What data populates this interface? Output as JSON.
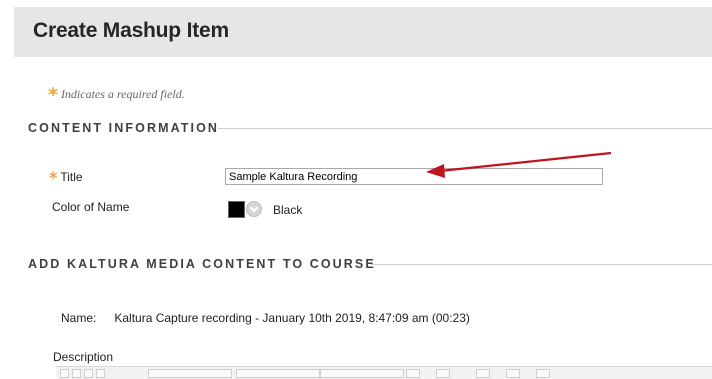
{
  "page": {
    "title": "Create Mashup Item"
  },
  "required_note": {
    "symbol": "*",
    "text": "Indicates a required field."
  },
  "sections": {
    "content_information": "CONTENT INFORMATION",
    "add_kaltura": "ADD KALTURA MEDIA CONTENT TO COURSE"
  },
  "fields": {
    "title": {
      "label": "Title",
      "required_symbol": "*",
      "value": "Sample Kaltura Recording"
    },
    "color_of_name": {
      "label": "Color of Name",
      "value": "Black",
      "swatch_color": "#000000"
    }
  },
  "media": {
    "name_label": "Name:",
    "name_value": "Kaltura Capture recording - January 10th 2019, 8:47:09 am (00:23)"
  },
  "description": {
    "label": "Description"
  },
  "annotation": {
    "arrow_color": "#c0141c"
  },
  "colors": {
    "required_star": "#f2a23a",
    "header_bg": "#e6e6e6"
  }
}
